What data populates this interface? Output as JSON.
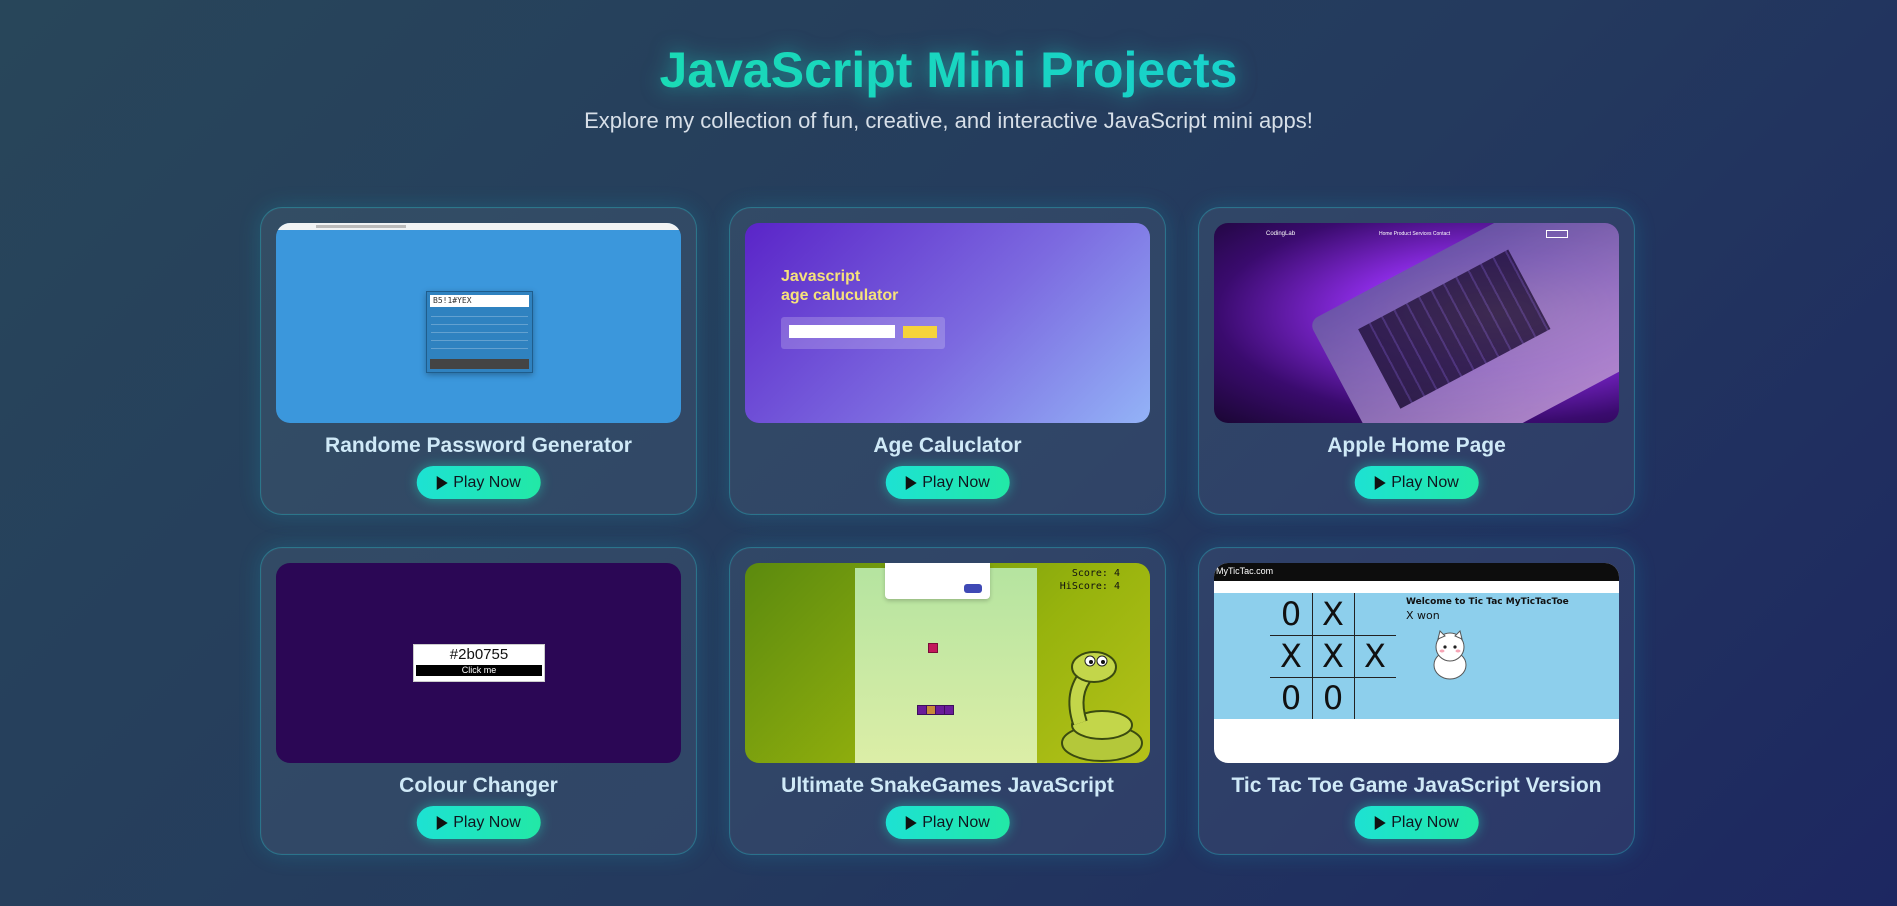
{
  "header": {
    "title": "JavaScript Mini Projects",
    "subtitle": "Explore my collection of fun, creative, and interactive JavaScript mini apps!"
  },
  "play_label": "Play Now",
  "accent_colors": {
    "title_gradient_start": "#1be49d",
    "title_gradient_end": "#17c7e4",
    "button_gradient_start": "#1de2d3",
    "button_gradient_end": "#22e8a6"
  },
  "projects": [
    {
      "title": "Randome Password Generator",
      "thumb_icon": "password-generator-preview",
      "preview_text": "B5!1#YEX"
    },
    {
      "title": "Age Caluclator",
      "thumb_icon": "age-calculator-preview",
      "preview_text": "Javascript\nage caluculator"
    },
    {
      "title": "Apple Home Page",
      "thumb_icon": "laptop-preview",
      "preview_text": "CodingLab",
      "preview_links": "Home  Product  Services  Contact"
    },
    {
      "title": "Colour Changer",
      "thumb_icon": "colour-changer-preview",
      "preview_text": "#2b0755",
      "preview_button": "Click me"
    },
    {
      "title": "Ultimate SnakeGames JavaScript",
      "thumb_icon": "snake-game-preview",
      "preview_text": "Score: 4\nHiScore: 4"
    },
    {
      "title": "Tic Tac Toe Game JavaScript Version",
      "thumb_icon": "tic-tac-toe-preview",
      "preview_text": "Welcome to Tic Tac MyTicTacToe",
      "preview_status": "X won",
      "preview_site": "MyTicTac.com",
      "board": [
        "0",
        "X",
        "",
        "X",
        "X",
        "X",
        "0",
        "0",
        ""
      ]
    }
  ]
}
